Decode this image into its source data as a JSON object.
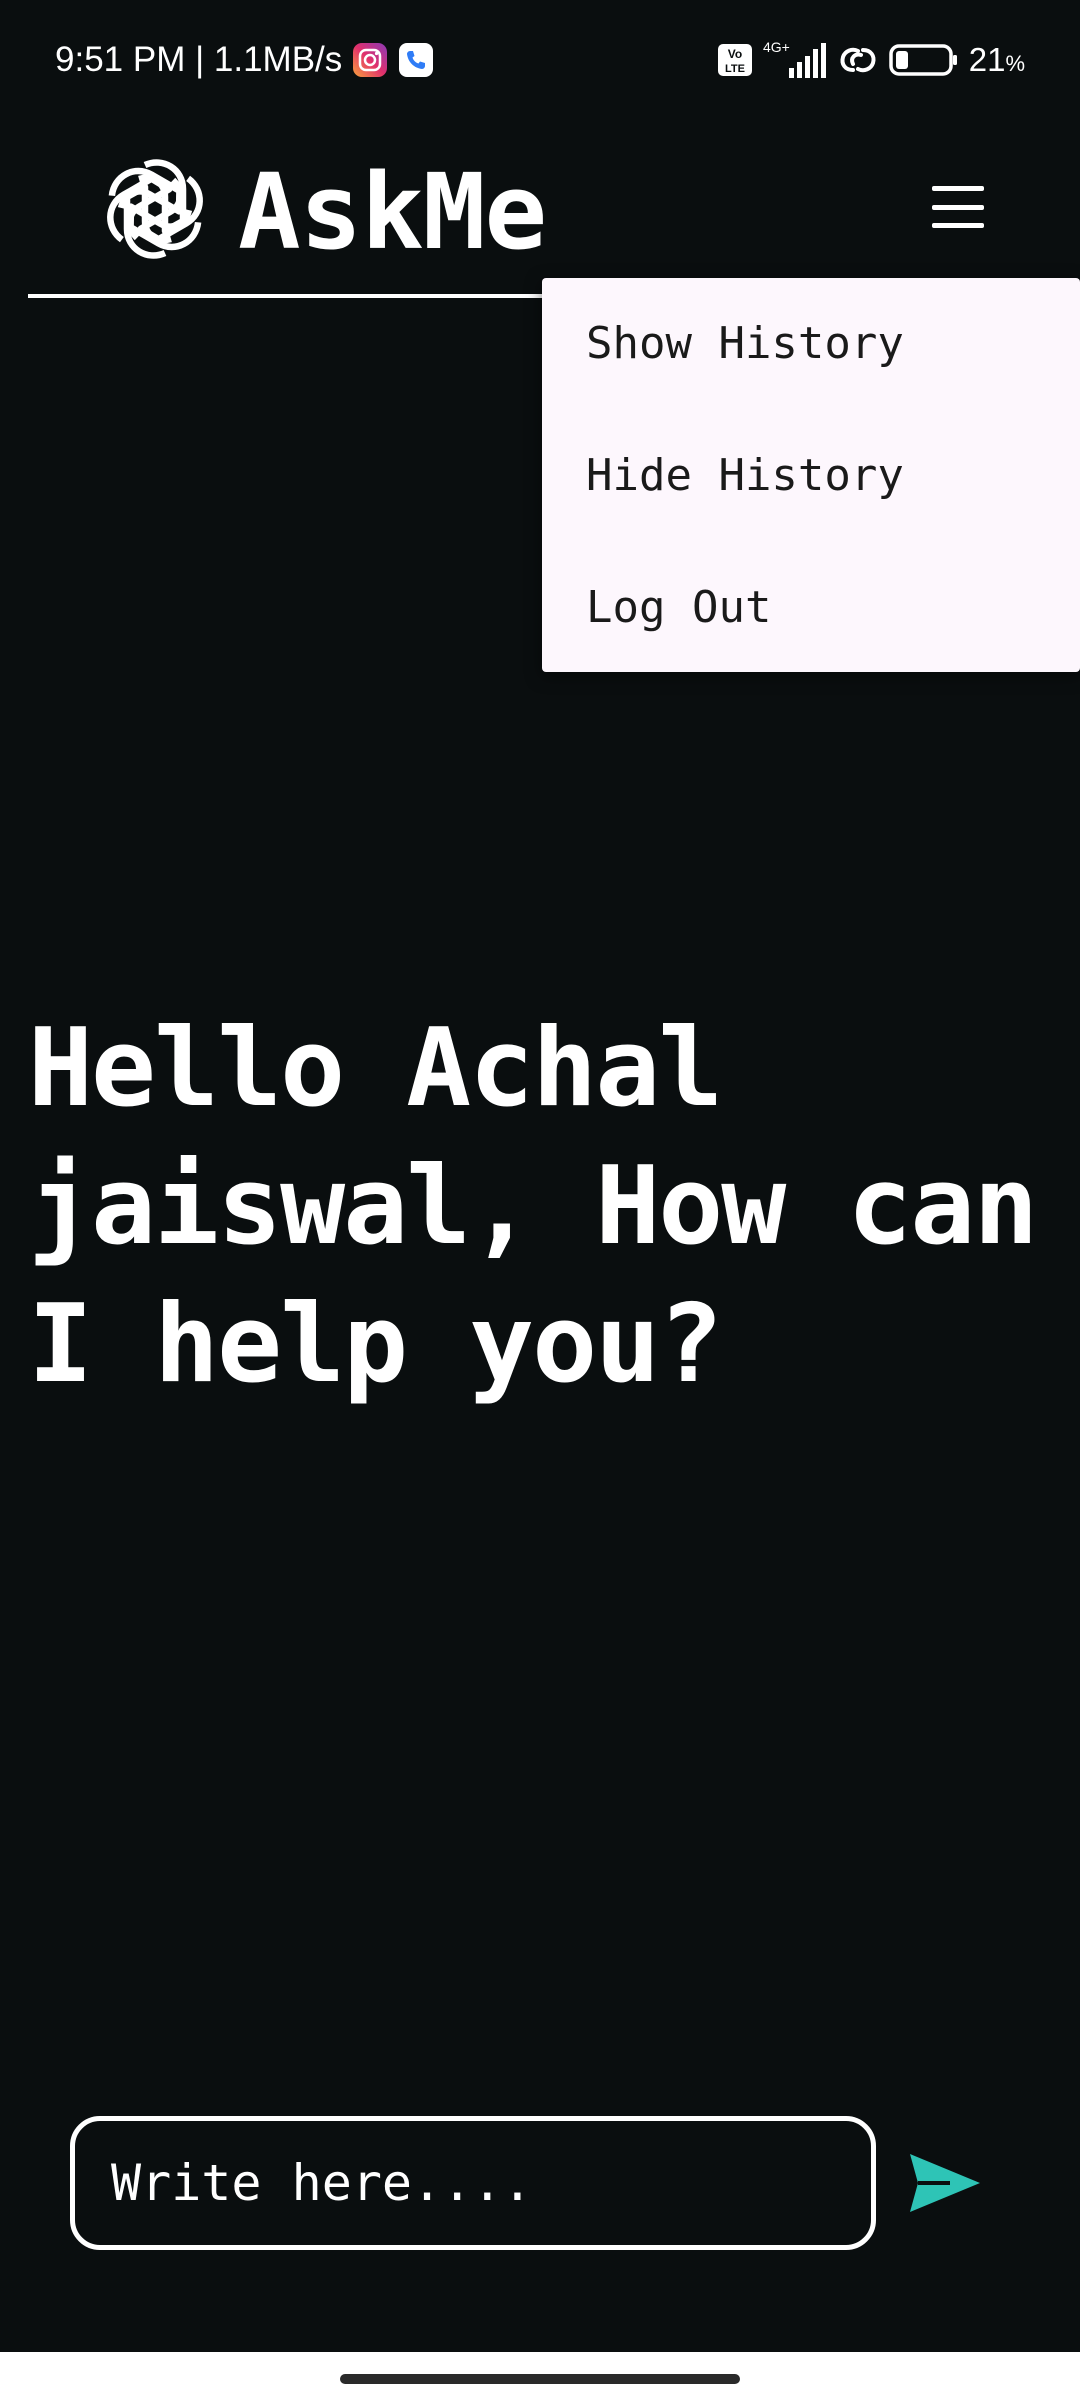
{
  "status_bar": {
    "time_speed": "9:51 PM | 1.1MB/s",
    "network": "4G+",
    "volte": "Vo LTE",
    "battery_value": "21",
    "battery_unit": "%",
    "battery_level": 0.21
  },
  "header": {
    "title": "AskMe",
    "logo_icon": "openai-logo-icon",
    "menu_icon": "hamburger-icon"
  },
  "menu": {
    "items": [
      {
        "label": "Show History"
      },
      {
        "label": "Hide History"
      },
      {
        "label": "Log Out"
      }
    ]
  },
  "main": {
    "greeting": "Hello Achal jaiswal, How can I help you?"
  },
  "chat": {
    "placeholder": "Write here....",
    "send_icon": "send-icon"
  },
  "colors": {
    "background": "#0a0e0f",
    "accent": "#2ec4b6",
    "menu_bg": "#fdf7fd"
  }
}
